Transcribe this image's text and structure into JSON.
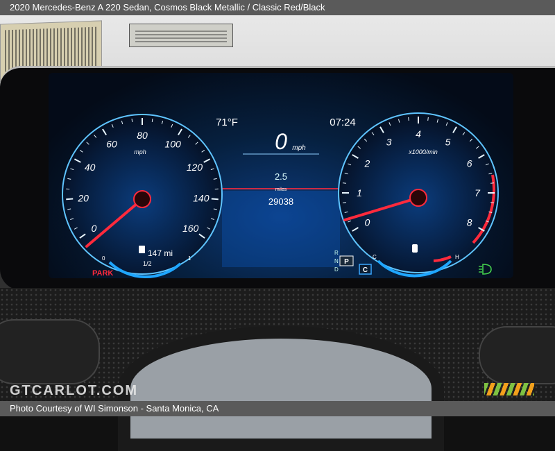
{
  "header": {
    "caption": "2020 Mercedes-Benz A 220 Sedan,  Cosmos Black Metallic / Classic Red/Black"
  },
  "footer": {
    "credit": "Photo Courtesy of WI Simonson - Santa Monica, CA"
  },
  "watermark": "GTCARLOT.COM",
  "cluster": {
    "outside_temp": "71°F",
    "clock": "07:24",
    "speed_value": "0",
    "speed_unit": "mph",
    "trip_value": "2.5",
    "trip_unit": "miles",
    "odometer": "29038",
    "park_label": "PARK",
    "fuel_range": "147 mi",
    "fuel_half": "1/2",
    "fuel_empty": "0",
    "fuel_full": "1",
    "gear_letters": [
      "R",
      "N",
      "D"
    ],
    "gear_selected": "P",
    "drive_mode": "C",
    "speedo_unit": "mph",
    "speedo_ticks": [
      "0",
      "20",
      "40",
      "60",
      "80",
      "100",
      "120",
      "140",
      "160"
    ],
    "tach_unit": "x1000/min",
    "tach_ticks": [
      "0",
      "1",
      "2",
      "3",
      "4",
      "5",
      "6",
      "7",
      "8"
    ],
    "temp_cold": "C",
    "temp_hot": "H",
    "speed_reading": 0,
    "rpm_reading": 0.9
  },
  "colors": {
    "accent_blue": "#1fa6ff",
    "needle_red": "#ff2a3c",
    "lights_green": "#44d14e"
  }
}
